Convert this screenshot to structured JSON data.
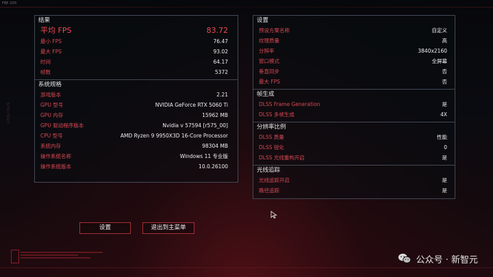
{
  "corner_label": "FBE 2D5",
  "side_text": "SYS//OUT",
  "results": {
    "title": "结果",
    "avg_fps_label": "平均 FPS",
    "avg_fps_value": "83.72",
    "rows": [
      {
        "label": "最小 FPS",
        "value": "76.47"
      },
      {
        "label": "最大 FPS",
        "value": "93.02"
      },
      {
        "label": "时间",
        "value": "64.17"
      },
      {
        "label": "帧数",
        "value": "5372"
      }
    ]
  },
  "system": {
    "title": "系统规格",
    "rows": [
      {
        "label": "游戏版本",
        "value": "2.21"
      },
      {
        "label": "GPU 型号",
        "value": "NVIDIA GeForce RTX 5060 Ti"
      },
      {
        "label": "GPU 内存",
        "value": "15962 MB"
      },
      {
        "label": "GPU 驱动程序版本",
        "value": "Nvidia v 57594 [r575_00]"
      },
      {
        "label": "CPU 型号",
        "value": "AMD Ryzen 9 9950X3D 16-Core Processor"
      },
      {
        "label": "系统内存",
        "value": "98304 MB"
      },
      {
        "label": "操作系统名称",
        "value": "Windows 11 专业版"
      },
      {
        "label": "操作系统版本",
        "value": "10.0.26100"
      }
    ]
  },
  "settings": {
    "title": "设置",
    "rows": [
      {
        "label": "预设方案名称",
        "value": "自定义"
      },
      {
        "label": "纹理质量",
        "value": "高"
      },
      {
        "label": "分辨率",
        "value": "3840x2160"
      },
      {
        "label": "窗口模式",
        "value": "全屏幕"
      },
      {
        "label": "垂直同步",
        "value": "否"
      },
      {
        "label": "最大 FPS",
        "value": "否"
      }
    ]
  },
  "frame_gen": {
    "title": "帧生成",
    "rows": [
      {
        "label": "DLSS Frame Generation",
        "value": "是"
      },
      {
        "label": "DLSS 多帧生成",
        "value": "4X"
      }
    ]
  },
  "res_scale": {
    "title": "分辨率比例",
    "rows": [
      {
        "label": "DLSS 质量",
        "value": "性能"
      },
      {
        "label": "DLSS 锐化",
        "value": "0"
      },
      {
        "label": "DLSS 光线重构开启",
        "value": "是"
      }
    ]
  },
  "ray_tracing": {
    "title": "光线追踪",
    "rows": [
      {
        "label": "光线追踪开启",
        "value": "是"
      },
      {
        "label": "路径追踪",
        "value": "是"
      }
    ]
  },
  "buttons": {
    "settings": "设置",
    "exit": "退出到主菜单"
  },
  "watermark": {
    "text": "公众号 · 新智元",
    "icon": "wechat-icon"
  },
  "colors": {
    "accent_red": "#ef4a54",
    "label_red": "#d94952",
    "border": "#434955",
    "button_border": "#a52f37"
  }
}
